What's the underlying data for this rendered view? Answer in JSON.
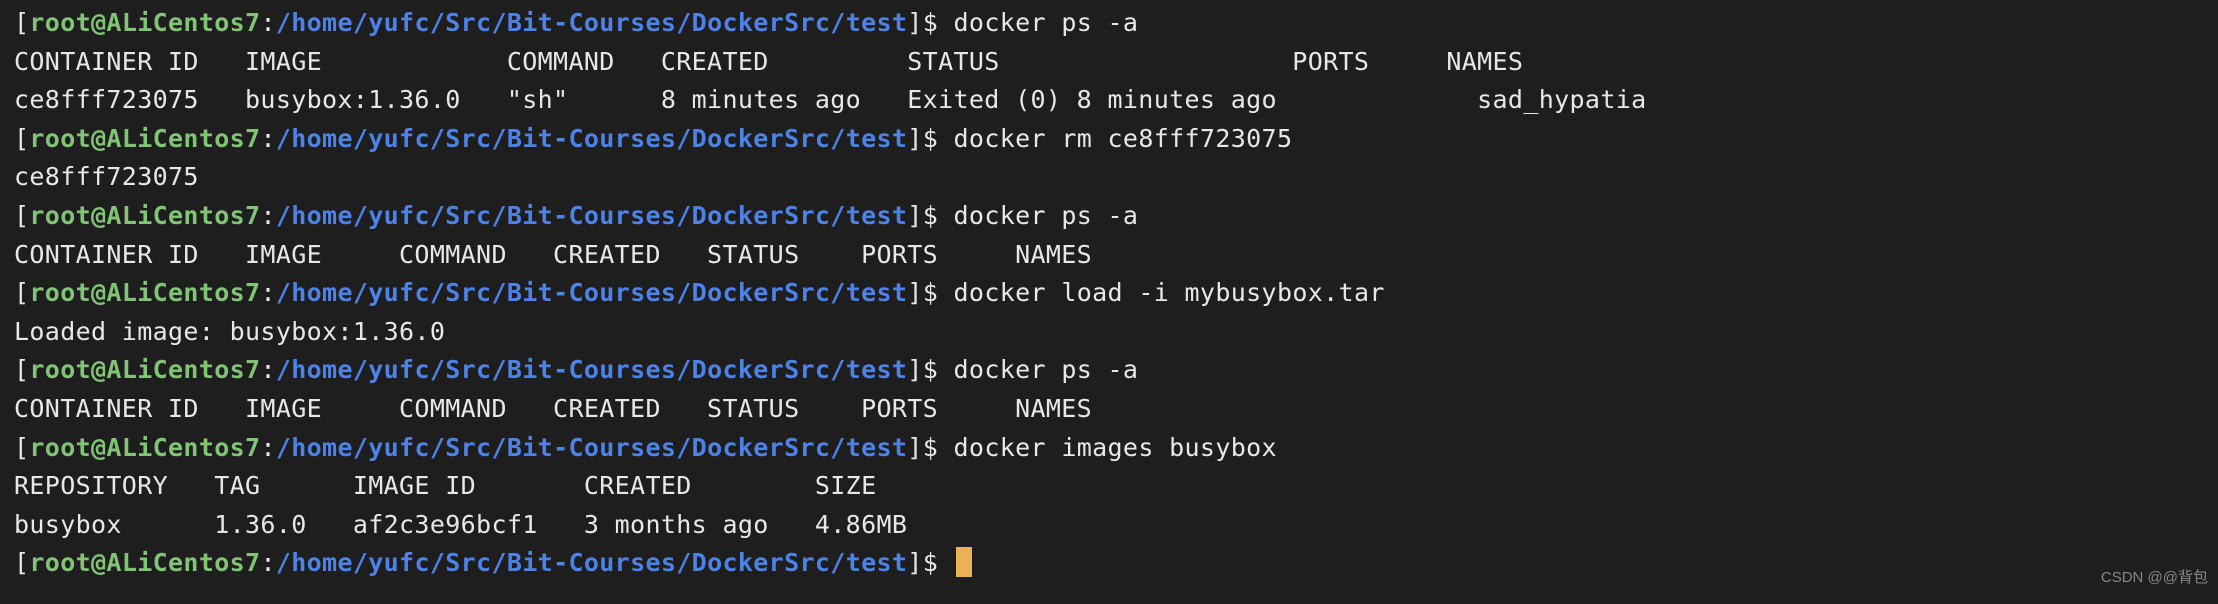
{
  "terminal": {
    "background_color": "#1e1e1e",
    "foreground_color": "#e8e8e8",
    "prompt_user_color": "#82c476",
    "prompt_path_color": "#4d82e8",
    "cursor_color": "#eab254",
    "prompt": {
      "open_bracket": "[",
      "user_host": "root@ALiCentos7",
      "colon": ":",
      "path": "/home/yufc/Src/Bit-Courses/DockerSrc/test",
      "close": "]$ "
    },
    "lines": [
      {
        "type": "prompt",
        "command": "docker ps -a"
      },
      {
        "type": "output",
        "text": "CONTAINER ID   IMAGE            COMMAND   CREATED         STATUS                   PORTS     NAMES"
      },
      {
        "type": "output",
        "text": "ce8fff723075   busybox:1.36.0   \"sh\"      8 minutes ago   Exited (0) 8 minutes ago             sad_hypatia"
      },
      {
        "type": "prompt",
        "command": "docker rm ce8fff723075"
      },
      {
        "type": "output",
        "text": "ce8fff723075"
      },
      {
        "type": "prompt",
        "command": "docker ps -a"
      },
      {
        "type": "output",
        "text": "CONTAINER ID   IMAGE     COMMAND   CREATED   STATUS    PORTS     NAMES"
      },
      {
        "type": "prompt",
        "command": "docker load -i mybusybox.tar"
      },
      {
        "type": "output",
        "text": "Loaded image: busybox:1.36.0"
      },
      {
        "type": "prompt",
        "command": "docker ps -a"
      },
      {
        "type": "output",
        "text": "CONTAINER ID   IMAGE     COMMAND   CREATED   STATUS    PORTS     NAMES"
      },
      {
        "type": "prompt",
        "command": "docker images busybox"
      },
      {
        "type": "output",
        "text": "REPOSITORY   TAG      IMAGE ID       CREATED        SIZE"
      },
      {
        "type": "output",
        "text": "busybox      1.36.0   af2c3e96bcf1   3 months ago   4.86MB"
      },
      {
        "type": "prompt",
        "command": "",
        "cursor": true
      }
    ],
    "tables": {
      "docker_ps_first": {
        "headers": [
          "CONTAINER ID",
          "IMAGE",
          "COMMAND",
          "CREATED",
          "STATUS",
          "PORTS",
          "NAMES"
        ],
        "rows": [
          [
            "ce8fff723075",
            "busybox:1.36.0",
            "\"sh\"",
            "8 minutes ago",
            "Exited (0) 8 minutes ago",
            "",
            "sad_hypatia"
          ]
        ]
      },
      "docker_ps_empty": {
        "headers": [
          "CONTAINER ID",
          "IMAGE",
          "COMMAND",
          "CREATED",
          "STATUS",
          "PORTS",
          "NAMES"
        ],
        "rows": []
      },
      "docker_images": {
        "headers": [
          "REPOSITORY",
          "TAG",
          "IMAGE ID",
          "CREATED",
          "SIZE"
        ],
        "rows": [
          [
            "busybox",
            "1.36.0",
            "af2c3e96bcf1",
            "3 months ago",
            "4.86MB"
          ]
        ]
      }
    }
  },
  "watermark": {
    "text": "CSDN @@背包"
  }
}
